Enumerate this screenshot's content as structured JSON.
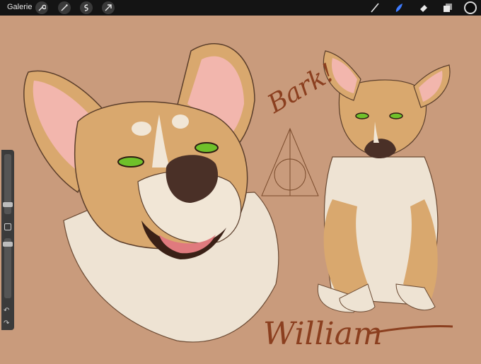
{
  "toolbar": {
    "gallery_label": "Galerie",
    "left_tools": [
      "wrench-icon",
      "magic-wand-icon",
      "selection-icon",
      "transform-arrow-icon"
    ],
    "right_tools": [
      "brush-icon",
      "smudge-icon",
      "eraser-icon",
      "layers-icon"
    ],
    "active_color": "#0b0b0b",
    "accent_color": "#3d7bff"
  },
  "sidebar": {
    "brush_size_level": 0.35,
    "opacity_level": 0.6,
    "undo_icon": "undo-icon",
    "redo_icon": "redo-icon"
  },
  "artwork": {
    "handwritten_text_1": "Bark!",
    "handwritten_text_2": "William",
    "background_color": "#c99b7c"
  }
}
